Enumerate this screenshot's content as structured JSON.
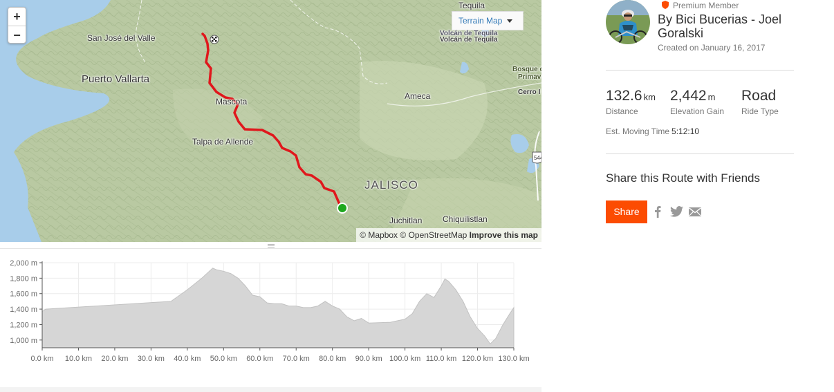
{
  "map": {
    "zoom_in_label": "+",
    "zoom_out_label": "−",
    "map_type": "Terrain Map",
    "labels": {
      "tequila": "Tequila",
      "volcan1": "Volcán de Tequila",
      "volcan2": "Volcán de Tequila",
      "san_jose": "San José del Valle",
      "puerto_vallarta": "Puerto Vallarta",
      "bosque": "Bosque d",
      "primav": "Primav",
      "cerro": "Cerro I",
      "ameca": "Ameca",
      "mascota": "Mascota",
      "talpa": "Talpa de Allende",
      "jalisco": "JALISCO",
      "juchitlan": "Juchitlan",
      "chiquilistlan": "Chiquilistlan",
      "highway": "544"
    },
    "attribution": {
      "mapbox": "© Mapbox",
      "osm": "© OpenStreetMap",
      "improve": "Improve this map"
    },
    "colors": {
      "route": "#e0171c",
      "start": "#1ea81e",
      "water": "#a8cdea",
      "land": "#b9c9a2"
    }
  },
  "chart_data": {
    "type": "area",
    "title": "",
    "xlabel": "",
    "ylabel": "",
    "x_unit": "km",
    "y_unit": "m",
    "xlim": [
      0,
      130
    ],
    "ylim": [
      900,
      2000
    ],
    "x_ticks": [
      "0.0 km",
      "10.0 km",
      "20.0 km",
      "30.0 km",
      "40.0 km",
      "50.0 km",
      "60.0 km",
      "70.0 km",
      "80.0 km",
      "90.0 km",
      "100.0 km",
      "110.0 km",
      "120.0 km",
      "130.0 km"
    ],
    "y_ticks": [
      "1,000 m",
      "1,200 m",
      "1,400 m",
      "1,600 m",
      "1,800 m",
      "2,000 m"
    ],
    "y_tick_values": [
      1000,
      1200,
      1400,
      1600,
      1800,
      2000
    ],
    "grid": true,
    "series": [
      {
        "x": [
          0,
          1,
          35.5,
          40,
          44,
          47,
          48,
          50,
          52,
          54,
          56,
          58,
          60,
          62,
          64,
          66,
          68,
          70,
          72,
          74,
          76,
          78,
          80,
          82,
          84,
          86,
          88,
          90,
          96,
          100,
          102,
          104,
          106,
          108,
          110,
          111,
          112,
          114,
          116,
          118,
          120,
          122,
          123.5,
          125,
          127,
          129,
          130
        ],
        "y": [
          1370,
          1400,
          1500,
          1650,
          1800,
          1930,
          1910,
          1890,
          1860,
          1800,
          1700,
          1580,
          1560,
          1480,
          1470,
          1470,
          1440,
          1440,
          1420,
          1420,
          1440,
          1500,
          1440,
          1400,
          1300,
          1250,
          1280,
          1220,
          1230,
          1270,
          1340,
          1500,
          1600,
          1550,
          1700,
          1790,
          1760,
          1650,
          1500,
          1300,
          1150,
          1050,
          950,
          1020,
          1200,
          1350,
          1420
        ]
      }
    ],
    "colors": {
      "fill": "#d6d6d6",
      "stroke": "#c2c2c2"
    }
  },
  "sidebar": {
    "premium": "Premium Member",
    "athlete_name": "By Bici Bucerias - Joel Goralski",
    "created": "Created on January 16, 2017",
    "stats": [
      {
        "value": "132.6",
        "unit": "km",
        "label": "Distance"
      },
      {
        "value": "2,442",
        "unit": "m",
        "label": "Elevation Gain"
      },
      {
        "value": "Road",
        "unit": "",
        "label": "Ride Type"
      }
    ],
    "moving_label": "Est. Moving Time",
    "moving_value": "5:12:10",
    "share_title": "Share this Route with Friends",
    "share_button": "Share",
    "social": [
      "facebook-icon",
      "twitter-icon",
      "email-icon"
    ],
    "colors": {
      "brand": "#fc4c02",
      "premium": "#fc4c02"
    }
  }
}
